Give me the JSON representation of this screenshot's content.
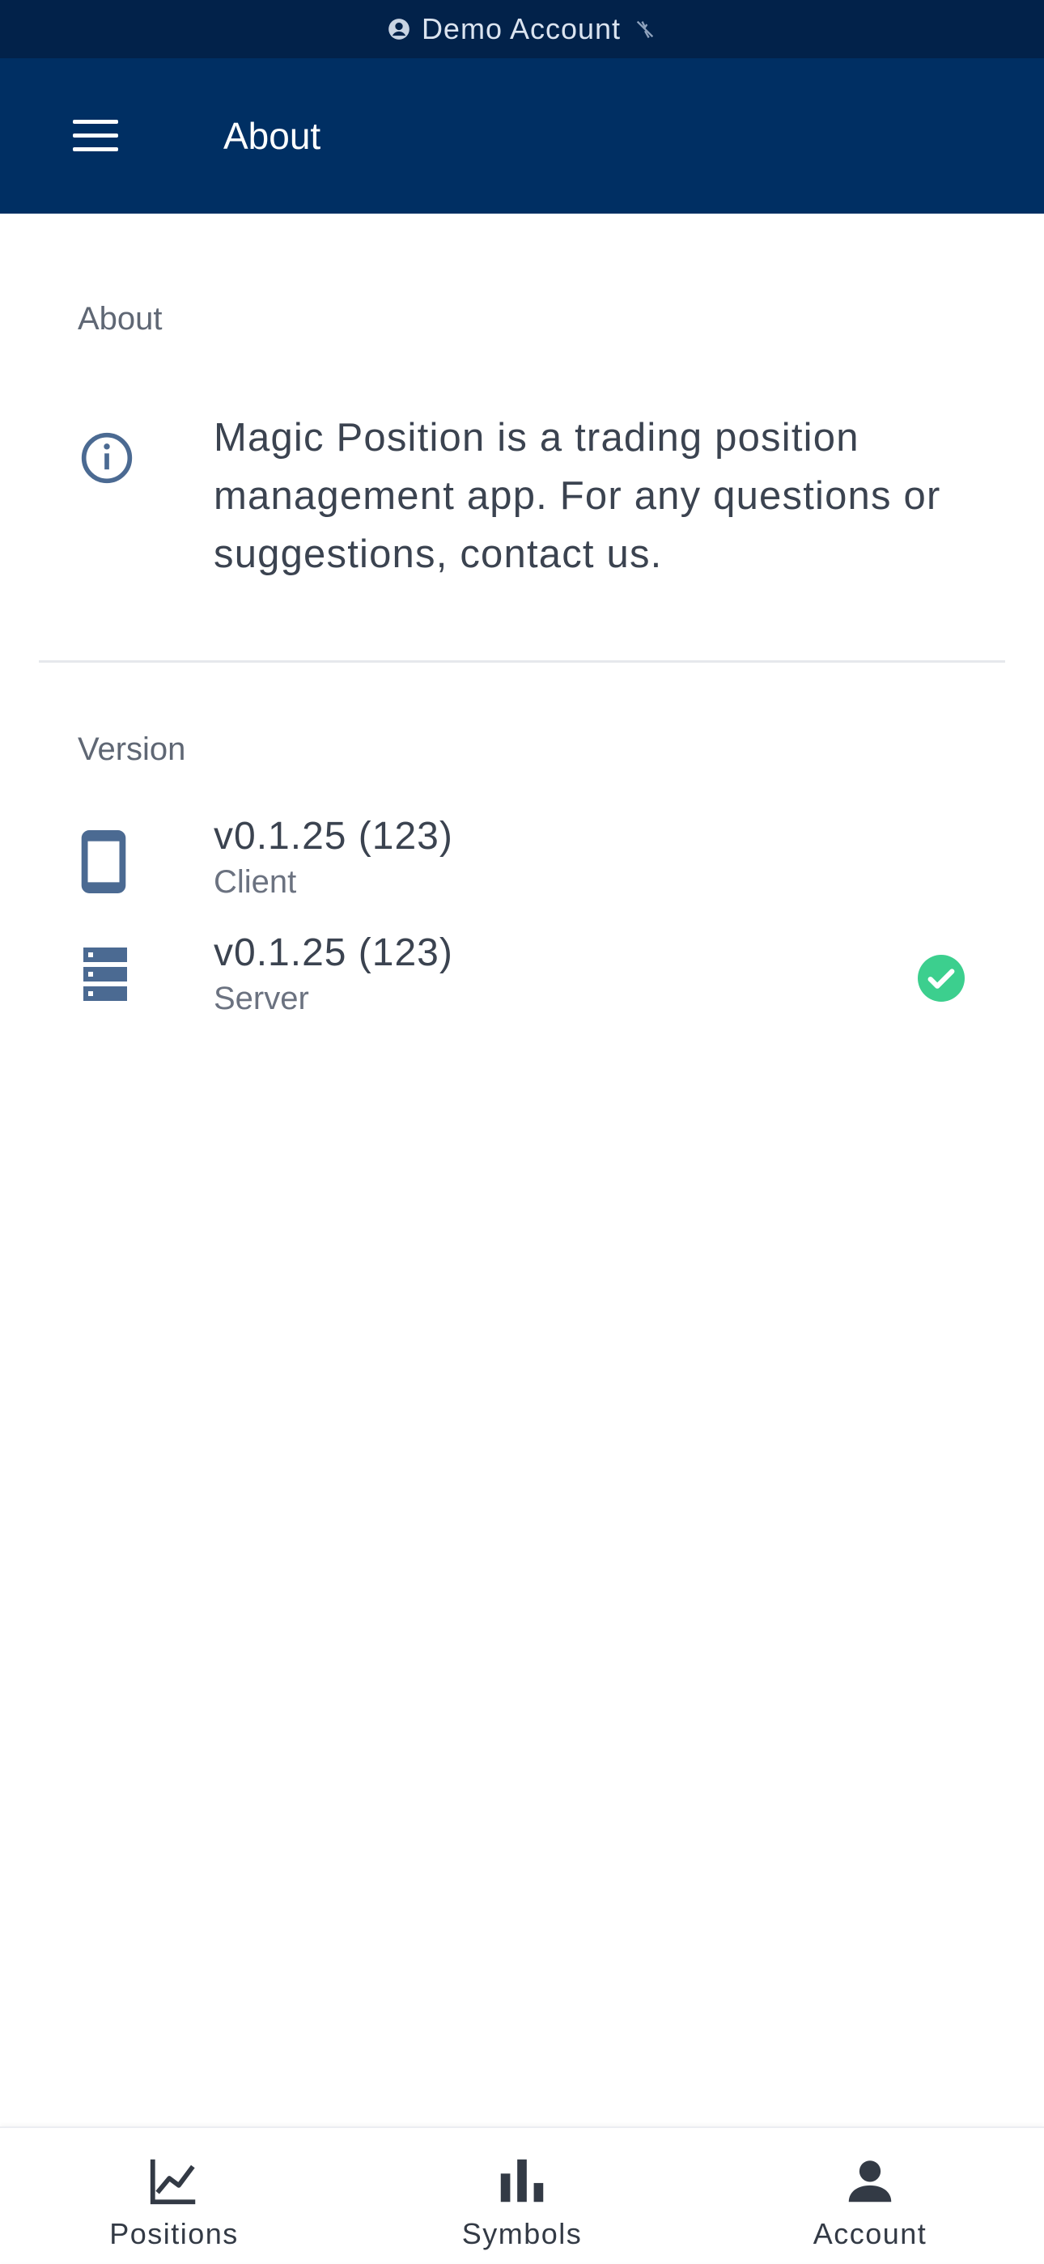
{
  "status_bar": {
    "account_label": "Demo Account",
    "icon_left": "account-circle-icon",
    "icon_right": "wifi-off-icon"
  },
  "app_bar": {
    "menu_icon": "hamburger-menu-icon",
    "title": "About"
  },
  "about_section": {
    "header": "About",
    "icon": "info-icon",
    "text": "Magic Position is a trading position management app. For any questions or suggestions, contact us."
  },
  "version_section": {
    "header": "Version",
    "items": [
      {
        "icon": "phone-icon",
        "value": "v0.1.25 (123)",
        "label": "Client"
      },
      {
        "icon": "server-icon",
        "value": "v0.1.25 (123)",
        "label": "Server",
        "status_icon": "check-circle-icon"
      }
    ]
  },
  "bottom_nav": {
    "items": [
      {
        "icon": "line-chart-icon",
        "label": "Positions"
      },
      {
        "icon": "bar-chart-icon",
        "label": "Symbols"
      },
      {
        "icon": "person-icon",
        "label": "Account"
      }
    ]
  },
  "colors": {
    "status_bar_bg": "#02224a",
    "app_bar_bg": "#002f63",
    "icon_blue": "#4b6a92",
    "success_green": "#3ccf8e"
  }
}
